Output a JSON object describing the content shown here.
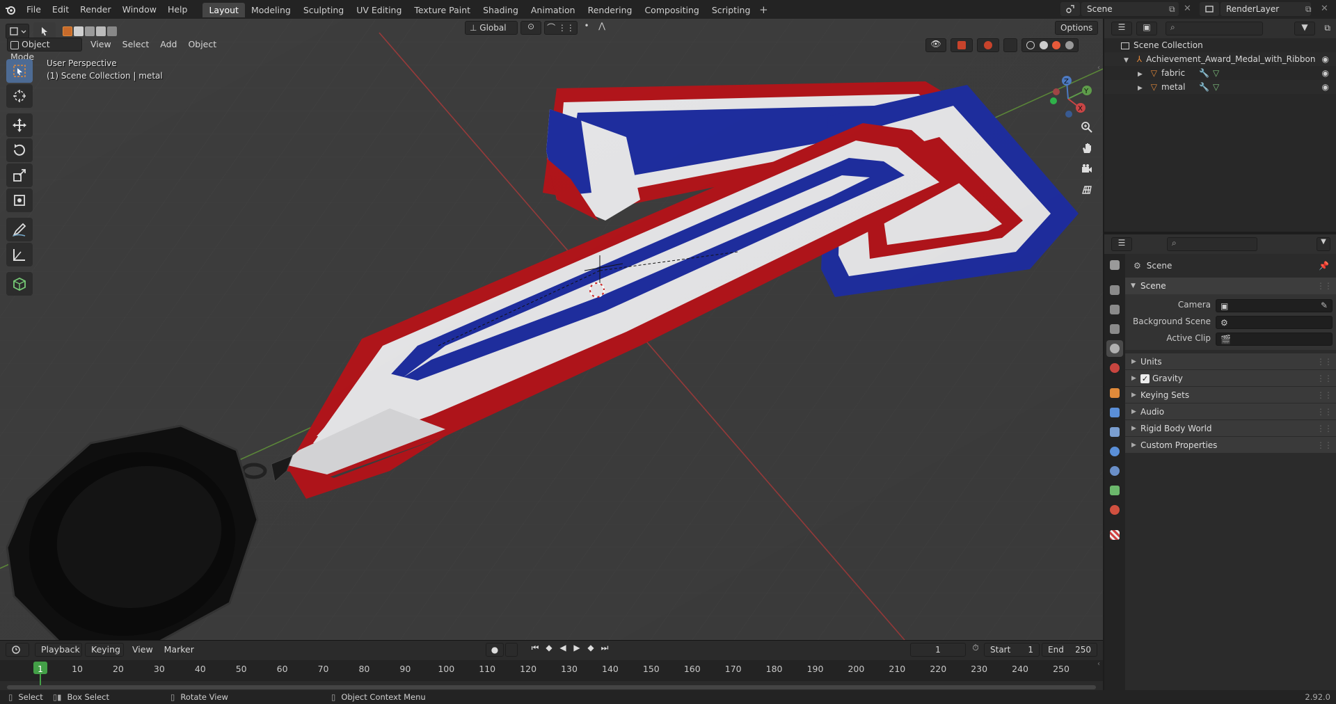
{
  "topbar": {
    "menus": [
      "File",
      "Edit",
      "Render",
      "Window",
      "Help"
    ],
    "workspaces": [
      "Layout",
      "Modeling",
      "Sculpting",
      "UV Editing",
      "Texture Paint",
      "Shading",
      "Animation",
      "Rendering",
      "Compositing",
      "Scripting"
    ],
    "active_workspace": "Layout",
    "add_tab": "+",
    "scene_name": "Scene",
    "view_layer": "RenderLayer"
  },
  "viewport": {
    "mode": "Object Mode",
    "menus": [
      "View",
      "Select",
      "Add",
      "Object"
    ],
    "transform_orientation": "Global",
    "options_label": "Options",
    "info_line1": "User Perspective",
    "info_line2": "(1) Scene Collection | metal",
    "gizmo_axes": {
      "x": "X",
      "y": "Y",
      "z": "Z"
    }
  },
  "timeline": {
    "menus": [
      "Playback",
      "Keying",
      "View",
      "Marker"
    ],
    "current_frame": "1",
    "start_label": "Start",
    "start_value": "1",
    "end_label": "End",
    "end_value": "250",
    "ticks": [
      {
        "label": "1",
        "frame": 1
      },
      {
        "label": "10",
        "frame": 10
      },
      {
        "label": "20",
        "frame": 20
      },
      {
        "label": "30",
        "frame": 30
      },
      {
        "label": "40",
        "frame": 40
      },
      {
        "label": "50",
        "frame": 50
      },
      {
        "label": "60",
        "frame": 60
      },
      {
        "label": "70",
        "frame": 70
      },
      {
        "label": "80",
        "frame": 80
      },
      {
        "label": "90",
        "frame": 90
      },
      {
        "label": "100",
        "frame": 100
      },
      {
        "label": "110",
        "frame": 110
      },
      {
        "label": "120",
        "frame": 120
      },
      {
        "label": "130",
        "frame": 130
      },
      {
        "label": "140",
        "frame": 140
      },
      {
        "label": "150",
        "frame": 150
      },
      {
        "label": "160",
        "frame": 160
      },
      {
        "label": "170",
        "frame": 170
      },
      {
        "label": "180",
        "frame": 180
      },
      {
        "label": "190",
        "frame": 190
      },
      {
        "label": "200",
        "frame": 200
      },
      {
        "label": "210",
        "frame": 210
      },
      {
        "label": "220",
        "frame": 220
      },
      {
        "label": "230",
        "frame": 230
      },
      {
        "label": "240",
        "frame": 240
      },
      {
        "label": "250",
        "frame": 250
      }
    ]
  },
  "statusbar": {
    "select": "Select",
    "box_select": "Box Select",
    "rotate_view": "Rotate View",
    "context_menu": "Object Context Menu",
    "version": "2.92.0"
  },
  "outliner": {
    "root": "Scene Collection",
    "items": [
      {
        "name": "Achievement_Award_Medal_with_Ribbon",
        "depth": 1
      },
      {
        "name": "fabric",
        "depth": 2
      },
      {
        "name": "metal",
        "depth": 2
      }
    ]
  },
  "properties": {
    "context_title": "Scene",
    "panel_title": "Scene",
    "camera_label": "Camera",
    "background_scene_label": "Background Scene",
    "active_clip_label": "Active Clip",
    "subpanels": [
      "Units",
      "Gravity",
      "Keying Sets",
      "Audio",
      "Rigid Body World",
      "Custom Properties"
    ],
    "gravity_checked": true
  },
  "colors": {
    "accent": "#4772b3",
    "ribbon_red": "#b3151b",
    "ribbon_white": "#e8e8ea",
    "ribbon_blue": "#1f2ea0",
    "active_tool": "#4d6b94",
    "frame_marker": "#43a047"
  }
}
